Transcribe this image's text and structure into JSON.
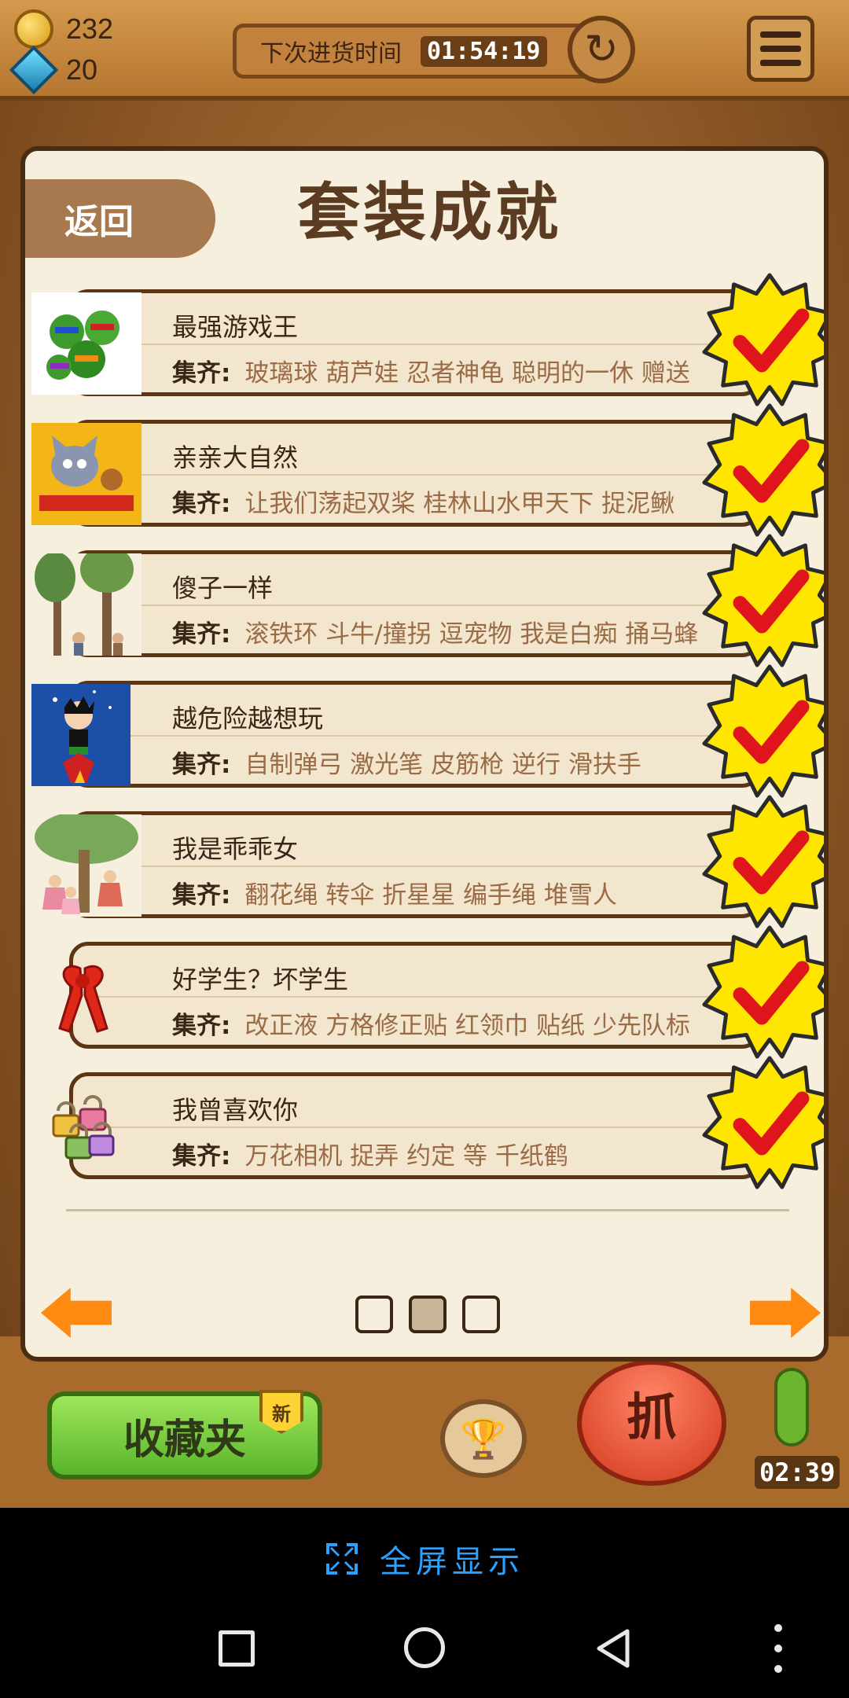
{
  "hud": {
    "coins": "232",
    "gems": "20",
    "restock_label": "下次进货时间",
    "restock_time": "01:54:19"
  },
  "panel": {
    "back_label": "返回",
    "title": "套装成就",
    "set_label": "集齐:"
  },
  "achievements": [
    {
      "name": "最强游戏王",
      "items": "玻璃球 葫芦娃 忍者神龟 聪明的一休 赠送",
      "thumb": "ninja-turtles-image",
      "completed": true
    },
    {
      "name": "亲亲大自然",
      "items": "让我们荡起双桨 桂林山水甲天下 捉泥鳅",
      "thumb": "tom-and-jerry-image",
      "completed": true
    },
    {
      "name": "傻子一样",
      "items": "滚铁环 斗牛/撞拐 逗宠物 我是白痴 捅马蜂",
      "thumb": "tree-climbing-image",
      "completed": true
    },
    {
      "name": "越危险越想玩",
      "items": "自制弹弓 激光笔 皮筋枪 逆行 滑扶手",
      "thumb": "astro-boy-image",
      "completed": true
    },
    {
      "name": "我是乖乖女",
      "items": "翻花绳 转伞 折星星 编手绳 堆雪人",
      "thumb": "girls-under-tree-image",
      "completed": true
    },
    {
      "name": "好学生？坏学生",
      "items": "改正液 方格修正贴 红领巾 贴纸 少先队标",
      "thumb": "red-scarf-ribbon-image",
      "completed": true
    },
    {
      "name": "我曾喜欢你",
      "items": "万花相机 捉弄 约定 等 千纸鹤",
      "thumb": "padlocks-image",
      "completed": true
    }
  ],
  "pagination": {
    "current": 2,
    "total": 3
  },
  "bottom": {
    "favorites_label": "收藏夹",
    "new_badge": "新",
    "grab_label": "抓",
    "countdown": "02:39"
  },
  "fullscreen": {
    "label": "全屏显示"
  },
  "colors": {
    "panel_bg": "#f7efdd",
    "border_brown": "#4a2c12",
    "item_text": "#9a6b45",
    "check_star": "#ffe600",
    "check_mark": "#e0141c",
    "arrow_orange": "#ff8a12",
    "fullscreen_blue": "#2aa2ff"
  }
}
